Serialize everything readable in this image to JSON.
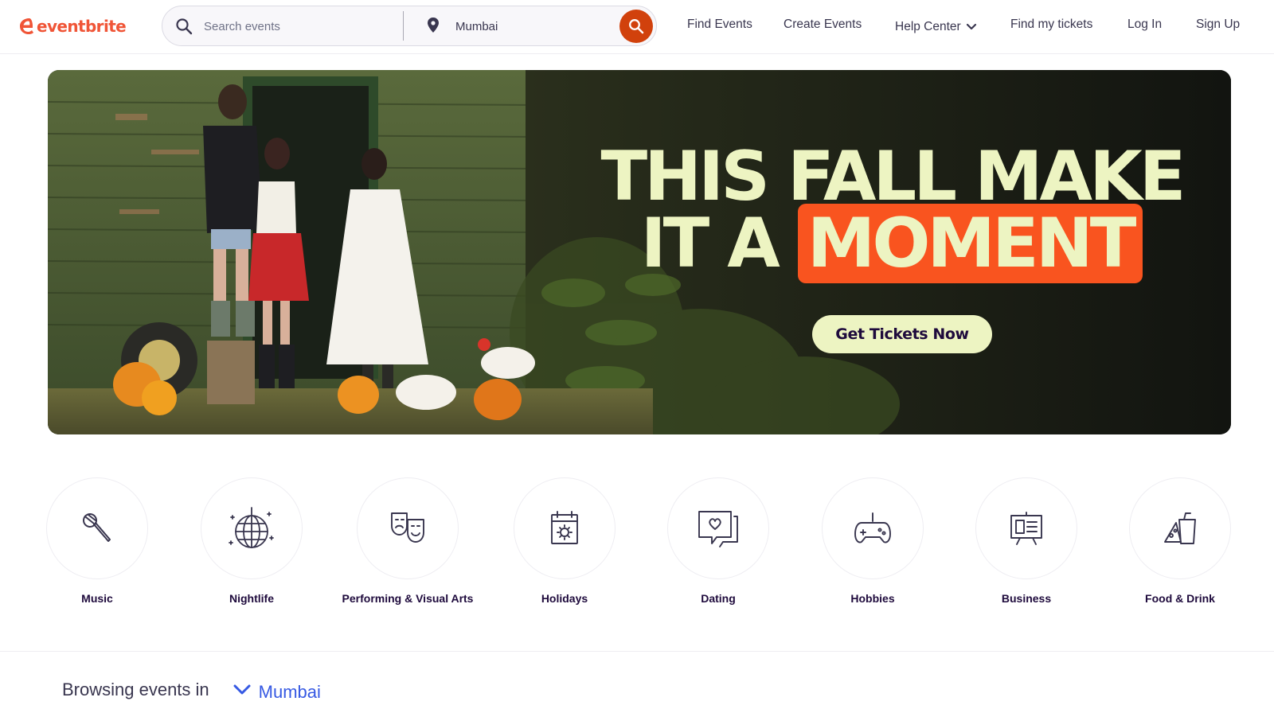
{
  "header": {
    "logo_text": "eventbrite",
    "search": {
      "placeholder": "Search events",
      "value": ""
    },
    "location": {
      "value": "Mumbai"
    },
    "nav": {
      "find_events": "Find Events",
      "create_events": "Create Events",
      "help_center": "Help Center",
      "find_tickets": "Find my tickets",
      "log_in": "Log In",
      "sign_up": "Sign Up"
    }
  },
  "hero": {
    "headline_line1": "THIS FALL MAKE",
    "headline_line2_prefix": "IT A",
    "headline_highlight": "MOMENT",
    "cta_label": "Get Tickets Now"
  },
  "categories": [
    {
      "label": "Music",
      "icon": "microphone-icon"
    },
    {
      "label": "Nightlife",
      "icon": "disco-ball-icon"
    },
    {
      "label": "Performing & Visual Arts",
      "icon": "theater-masks-icon"
    },
    {
      "label": "Holidays",
      "icon": "calendar-sun-icon"
    },
    {
      "label": "Dating",
      "icon": "chat-heart-icon"
    },
    {
      "label": "Hobbies",
      "icon": "gamepad-icon"
    },
    {
      "label": "Business",
      "icon": "presentation-board-icon"
    },
    {
      "label": "Food & Drink",
      "icon": "food-drink-icon"
    }
  ],
  "browsing": {
    "label": "Browsing events in",
    "city": "Mumbai"
  },
  "colors": {
    "brand": "#f05537",
    "search_button": "#d1410c",
    "hero_text": "#edf4c2",
    "hero_highlight": "#f9541f",
    "link_blue": "#3659e3",
    "text_dark": "#1e0a3c"
  }
}
